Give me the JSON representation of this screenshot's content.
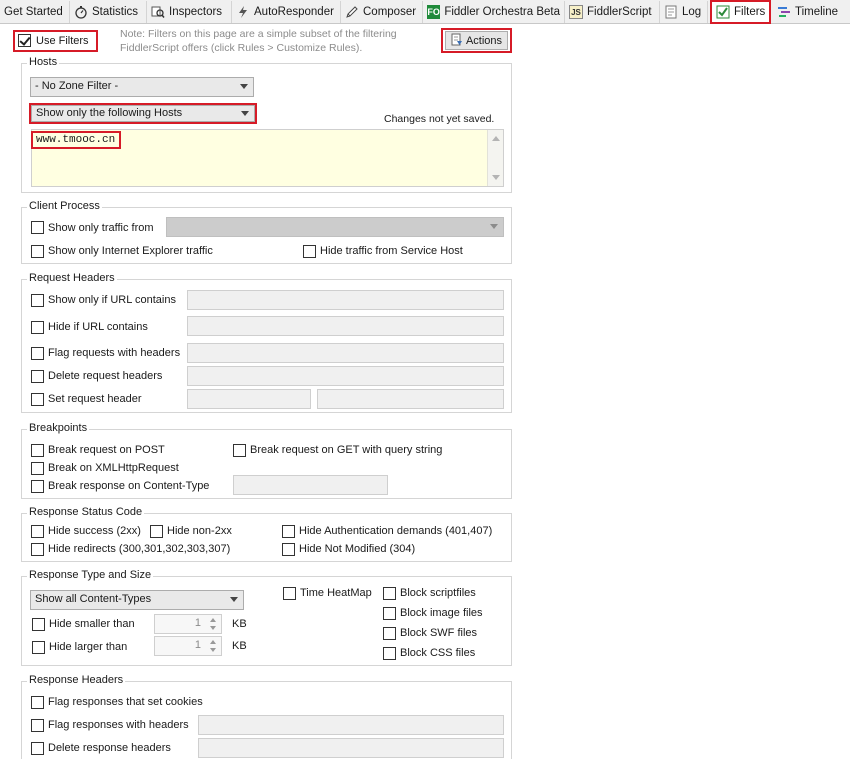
{
  "tabs": [
    {
      "label": "Get Started",
      "icon": ""
    },
    {
      "label": "Statistics",
      "icon": "stopwatch-icon"
    },
    {
      "label": "Inspectors",
      "icon": "inspect-icon"
    },
    {
      "label": "AutoResponder",
      "icon": "lightning-icon"
    },
    {
      "label": "Composer",
      "icon": "pencil-icon"
    },
    {
      "label": "Fiddler Orchestra Beta",
      "icon": "fo-icon",
      "icon_text": "FO"
    },
    {
      "label": "FiddlerScript",
      "icon": "script-icon",
      "icon_text": "JS"
    },
    {
      "label": "Log",
      "icon": "log-icon"
    },
    {
      "label": "Filters",
      "icon": "checkbox-icon",
      "active": true
    },
    {
      "label": "Timeline",
      "icon": "timeline-icon"
    }
  ],
  "top": {
    "use_filters_label": "Use Filters",
    "use_filters_checked": true,
    "note_line1": "Note: Filters on this page are a simple subset of the filtering",
    "note_line2": "FiddlerScript offers (click Rules > Customize Rules).",
    "actions_label": "Actions"
  },
  "hosts": {
    "title": "Hosts",
    "zone_filter": "- No Zone Filter -",
    "host_filter": "Show only the following Hosts",
    "status": "Changes not yet saved.",
    "hosts_text": "www.tmooc.cn"
  },
  "client_process": {
    "title": "Client Process",
    "show_only_traffic_from": "Show only traffic from",
    "show_only_ie": "Show only Internet Explorer traffic",
    "hide_service_host": "Hide traffic from Service Host"
  },
  "request_headers": {
    "title": "Request Headers",
    "show_if_url": "Show only if URL contains",
    "hide_if_url": "Hide if URL contains",
    "flag_with_headers": "Flag requests with headers",
    "delete_headers": "Delete request headers",
    "set_header": "Set request header"
  },
  "breakpoints": {
    "title": "Breakpoints",
    "break_post": "Break request on POST",
    "break_get_query": "Break request on GET with query string",
    "break_xhr": "Break on XMLHttpRequest",
    "break_response_ct": "Break response on Content-Type"
  },
  "status_code": {
    "title": "Response Status Code",
    "hide_success": "Hide success (2xx)",
    "hide_non2xx": "Hide non-2xx",
    "hide_auth": "Hide Authentication demands (401,407)",
    "hide_redirects": "Hide redirects (300,301,302,303,307)",
    "hide_not_modified": "Hide Not Modified (304)"
  },
  "type_size": {
    "title": "Response Type and Size",
    "content_types": "Show all Content-Types",
    "time_heatmap": "Time HeatMap",
    "block_script": "Block scriptfiles",
    "block_image": "Block image files",
    "block_swf": "Block SWF files",
    "block_css": "Block CSS files",
    "hide_smaller": "Hide smaller than",
    "hide_larger": "Hide larger than",
    "smaller_value": "1",
    "larger_value": "1",
    "unit": "KB"
  },
  "response_headers": {
    "title": "Response Headers",
    "flag_cookies": "Flag responses that set cookies",
    "flag_with_headers": "Flag responses with headers",
    "delete_headers": "Delete response headers"
  },
  "colors": {
    "highlight": "#d61b27",
    "hosts_bg": "#ffffe1",
    "disabled_bg": "#cccccc"
  }
}
